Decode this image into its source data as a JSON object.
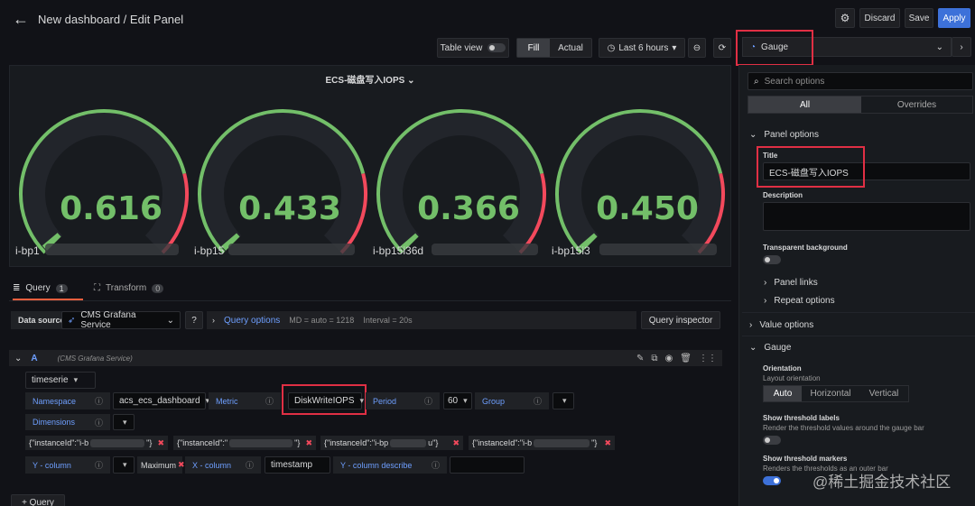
{
  "header": {
    "title": "New dashboard / Edit Panel",
    "discard": "Discard",
    "save": "Save",
    "apply": "Apply"
  },
  "toolbar": {
    "table_view": "Table view",
    "fill": "Fill",
    "actual": "Actual",
    "time_range": "Last 6 hours",
    "visualization": "Gauge"
  },
  "panel": {
    "title": "ECS-磁盘写入IOPS",
    "gauges": [
      {
        "value": "0.616",
        "value_num": 0.616,
        "label": "i-bp1"
      },
      {
        "value": "0.433",
        "value_num": 0.433,
        "label": "i-bp15"
      },
      {
        "value": "0.366",
        "value_num": 0.366,
        "label": "i-bp15i36d"
      },
      {
        "value": "0.450",
        "value_num": 0.45,
        "label": "i-bp15i3"
      }
    ]
  },
  "tabs": {
    "query": "Query",
    "query_count": "1",
    "transform": "Transform",
    "transform_count": "0"
  },
  "datasource": {
    "label": "Data source",
    "name": "CMS Grafana Service",
    "query_options": "Query options",
    "md": "MD = auto = 1218",
    "interval": "Interval = 20s",
    "inspector": "Query inspector"
  },
  "query": {
    "ref": "A",
    "source": "(CMS Grafana Service)",
    "type": "timeserie",
    "namespace_label": "Namespace",
    "namespace_value": "acs_ecs_dashboard",
    "metric_label": "Metric",
    "metric_value": "DiskWriteIOPS",
    "period_label": "Period",
    "period_value": "60",
    "group_label": "Group",
    "dimensions_label": "Dimensions",
    "dims": [
      "{\"instanceId\":\"i-b",
      "{\"instanceId\":\"",
      "{\"instanceId\":\"i-bp",
      "{\"instanceId\":\"i-b"
    ],
    "ycol_label": "Y - column",
    "ycol_value": "Maximum",
    "xcol_label": "X - column",
    "xcol_value": "timestamp",
    "ycol_desc_label": "Y - column describe",
    "add_query": "+ Query"
  },
  "options": {
    "search_placeholder": "Search options",
    "all": "All",
    "overrides": "Overrides",
    "panel_options": "Panel options",
    "title_label": "Title",
    "title_value": "ECS-磁盘写入IOPS",
    "description_label": "Description",
    "transparent_label": "Transparent background",
    "panel_links": "Panel links",
    "repeat_options": "Repeat options",
    "value_options": "Value options",
    "gauge": "Gauge",
    "orientation_label": "Orientation",
    "orientation_desc": "Layout orientation",
    "orient_auto": "Auto",
    "orient_horizontal": "Horizontal",
    "orient_vertical": "Vertical",
    "threshold_labels": "Show threshold labels",
    "threshold_labels_desc": "Render the threshold values around the gauge bar",
    "threshold_markers": "Show threshold markers",
    "threshold_markers_desc": "Renders the thresholds as an outer bar"
  },
  "watermark": "@稀土掘金技术社区",
  "colors": {
    "green": "#73bf69",
    "red": "#f2495c",
    "accent": "#3d71d9"
  }
}
